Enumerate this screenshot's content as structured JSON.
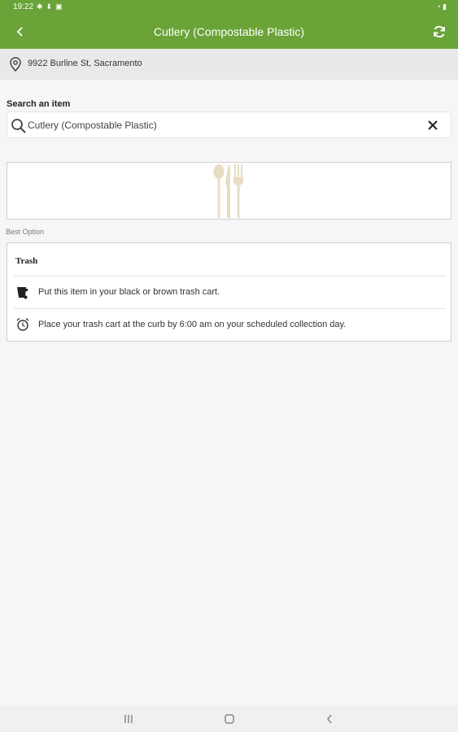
{
  "status_bar": {
    "time": "19:22",
    "left_icons": [
      "settings-icon",
      "download-icon",
      "sim-icon"
    ],
    "right_icons": [
      "wifi-icon",
      "battery-icon"
    ]
  },
  "app_bar": {
    "title": "Cutlery (Compostable Plastic)",
    "back_icon": "back-arrow-icon",
    "refresh_icon": "refresh-icon",
    "color": "#6aa338"
  },
  "address": {
    "text": "9922 Burline St, Sacramento",
    "icon": "location-pin-icon"
  },
  "search": {
    "label": "Search an item",
    "value": "Cutlery (Compostable Plastic)",
    "icon": "search-icon",
    "clear_icon": "close-icon"
  },
  "item_image": {
    "icon": "cutlery-icon",
    "color": "#e8dcc3"
  },
  "best_option": {
    "label": "Best Option",
    "title": "Trash",
    "instructions": [
      {
        "icon": "trash-cart-icon",
        "text": "Put this item in your black or brown trash cart."
      },
      {
        "icon": "alarm-clock-icon",
        "text": "Place your trash cart at the curb by 6:00 am on your scheduled collection day."
      }
    ]
  },
  "nav_bar": {
    "buttons": [
      "recents-icon",
      "home-icon",
      "back-icon"
    ]
  }
}
